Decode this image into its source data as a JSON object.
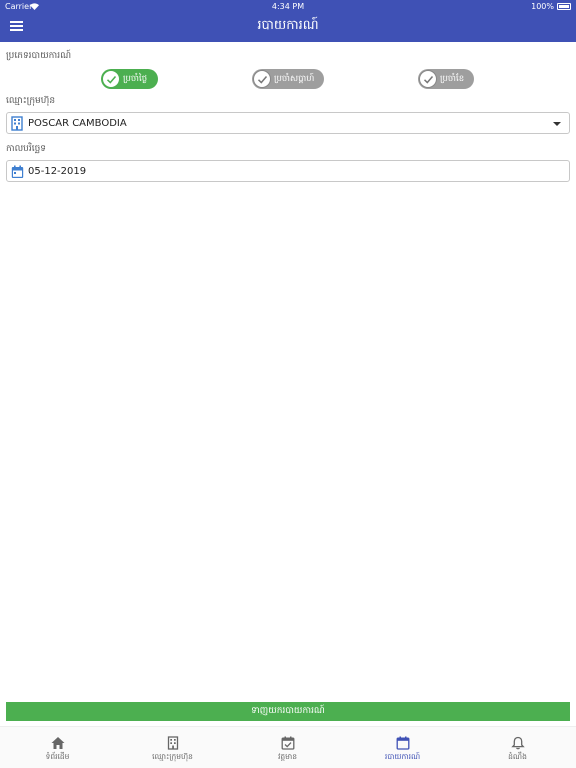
{
  "status": {
    "carrier": "Carrier",
    "time": "4:34 PM",
    "battery": "100%"
  },
  "header": {
    "title": "របាយការណ៍",
    "menu_icon": "hamburger-icon"
  },
  "report_type": {
    "label": "ប្រភេទរបាយការណ៍",
    "options": [
      {
        "label": "ប្រចាំថ្ងៃ",
        "selected": true
      },
      {
        "label": "ប្រចាំសប្តាហ៍",
        "selected": false
      },
      {
        "label": "ប្រចាំខែ",
        "selected": false
      }
    ]
  },
  "company": {
    "label": "ឈ្មោះក្រុមហ៊ុន",
    "value": "POSCAR CAMBODIA",
    "icon": "building-icon"
  },
  "date": {
    "label": "កាលបរិច្ឆេទ",
    "value": "05-12-2019",
    "icon": "calendar-icon"
  },
  "submit_label": "ទាញយករបាយការណ៍",
  "tabs": [
    {
      "label": "ទំព័រដើម",
      "icon": "home-icon"
    },
    {
      "label": "ឈ្មោះក្រុមហ៊ុន",
      "icon": "building-icon"
    },
    {
      "label": "វត្តមាន",
      "icon": "calendar-check-icon"
    },
    {
      "label": "របាយការណ៍",
      "icon": "calendar-icon",
      "active": true
    },
    {
      "label": "ដំណឹង",
      "icon": "bell-icon"
    }
  ],
  "colors": {
    "primary": "#3f51b5",
    "accent_green": "#4caf50",
    "inactive_grey": "#9e9e9e"
  }
}
